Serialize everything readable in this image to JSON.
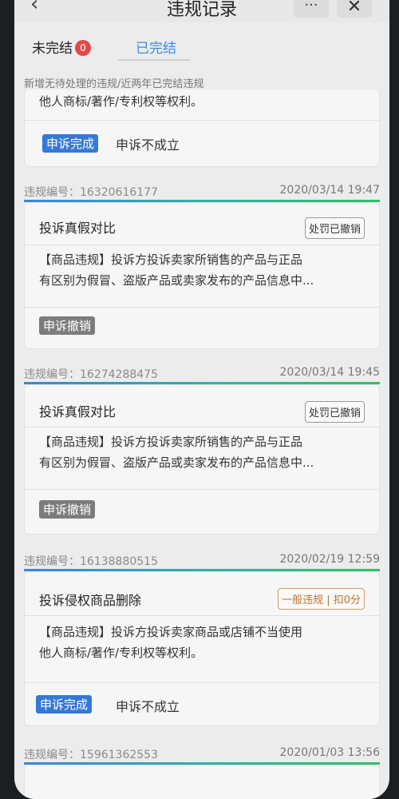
{
  "header": {
    "title": "违规记录",
    "back_icon": "‹",
    "more_icon": "···",
    "close_icon": "✕"
  },
  "tabs": [
    {
      "label": "未完结",
      "badge": "0"
    },
    {
      "label": "已完结"
    }
  ],
  "notice": "新增无待处理的违规/近两年已完结违规",
  "top_card": {
    "text": "他人商标/著作/专利权等权利。",
    "appeal_tag": "申诉完成",
    "appeal_result": "申诉不成立"
  },
  "records": [
    {
      "id_label": "违规编号：16320616177",
      "date": "2020/03/14 19:47",
      "title": "投诉真假对比",
      "status": "处罚已撤销",
      "desc_line1": "【商品违规】投诉方投诉卖家所销售的产品与正品",
      "desc_line2": "有区别为假冒、盗版产品或卖家发布的产品信息中...",
      "appeal_tag": "申诉撤销",
      "appeal_result": ""
    },
    {
      "id_label": "违规编号：16274288475",
      "date": "2020/03/14 19:45",
      "title": "投诉真假对比",
      "status": "处罚已撤销",
      "desc_line1": "【商品违规】投诉方投诉卖家所销售的产品与正品",
      "desc_line2": "有区别为假冒、盗版产品或卖家发布的产品信息中...",
      "appeal_tag": "申诉撤销",
      "appeal_result": ""
    },
    {
      "id_label": "违规编号：16138880515",
      "date": "2020/02/19 12:59",
      "title": "投诉侵权商品删除",
      "status": "一般违规 | 扣0分",
      "desc_line1": "【商品违规】投诉方投诉卖家商品或店铺不当使用",
      "desc_line2": "他人商标/著作/专利权等权利。",
      "appeal_tag": "申诉完成",
      "appeal_result": "申诉不成立"
    },
    {
      "id_label": "违规编号：15961362553",
      "date": "2020/01/03 13:56"
    }
  ]
}
